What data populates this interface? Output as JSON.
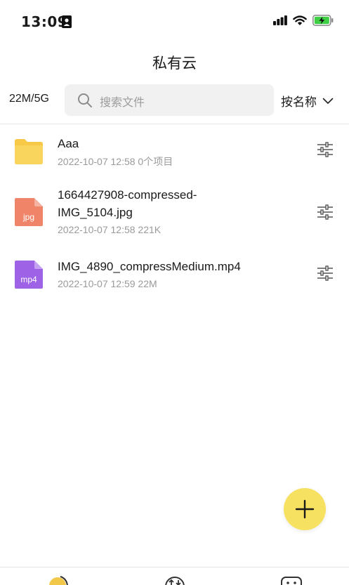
{
  "status": {
    "time": "13:09",
    "icons": [
      "contact-card-icon",
      "signal-icon",
      "wifi-icon",
      "battery-charging-icon"
    ],
    "battery_color": "#3ecf45"
  },
  "nav": {
    "title": "私有云"
  },
  "toolbar": {
    "quota": "22M/5G",
    "search_placeholder": "搜索文件",
    "sort_label": "按名称"
  },
  "files": [
    {
      "name": "Aaa",
      "meta": "2022-10-07 12:58 0个项目",
      "type": "folder",
      "icon_label": ""
    },
    {
      "name": "1664427908-compressed-IMG_5104.jpg",
      "meta": "2022-10-07 12:58 221K",
      "type": "jpg",
      "icon_label": "jpg"
    },
    {
      "name": "IMG_4890_compressMedium.mp4",
      "meta": "2022-10-07 12:59 22M",
      "type": "mp4",
      "icon_label": "mp4"
    }
  ],
  "colors": {
    "folder": "#f7c946",
    "jpg": "#ef8469",
    "mp4": "#9e62e6",
    "fab": "#f7e160",
    "tab_active": "#f2c84b"
  },
  "tabs": [
    "cloud-icon",
    "transfer-icon",
    "profile-icon"
  ]
}
